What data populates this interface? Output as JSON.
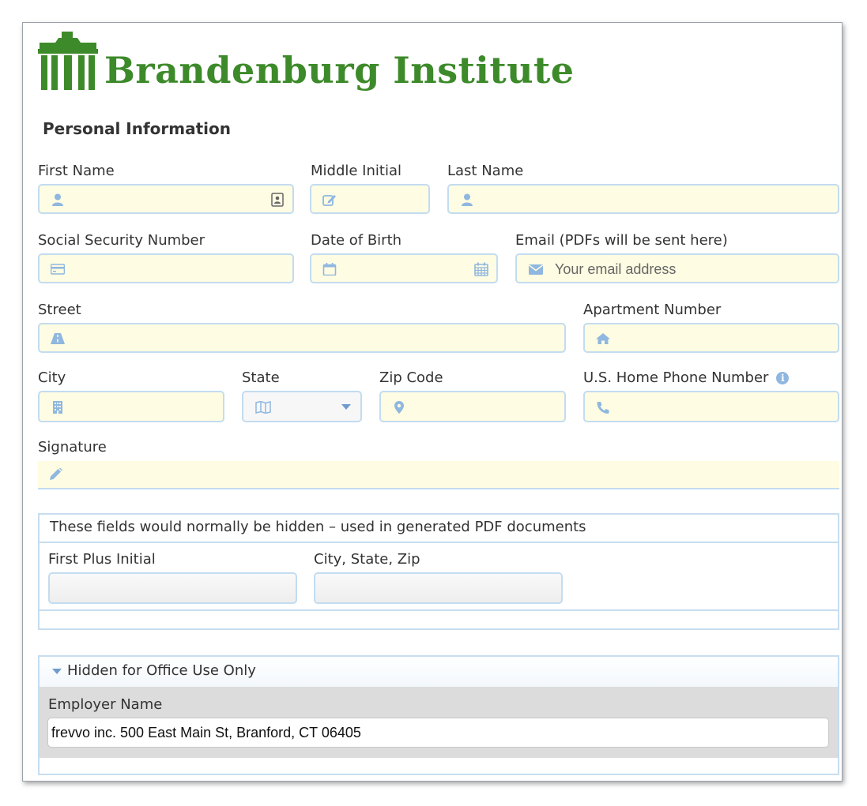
{
  "brand": {
    "name": "Brandenburg Institute",
    "color": "#3d8a2a"
  },
  "section": {
    "title": "Personal Information"
  },
  "fields": {
    "first_name": {
      "label": "First Name",
      "icon": "user-icon",
      "right_icon": "contact-card-icon"
    },
    "middle_initial": {
      "label": "Middle Initial",
      "icon": "edit-icon"
    },
    "last_name": {
      "label": "Last Name",
      "icon": "user-icon"
    },
    "ssn": {
      "label": "Social Security Number",
      "icon": "credit-card-icon"
    },
    "dob": {
      "label": "Date of Birth",
      "icon": "calendar-icon",
      "right_icon": "calendar-grid-icon"
    },
    "email": {
      "label": "Email (PDFs will be sent here)",
      "icon": "envelope-icon",
      "placeholder": "Your email address"
    },
    "street": {
      "label": "Street",
      "icon": "road-icon"
    },
    "apartment": {
      "label": "Apartment Number",
      "icon": "home-icon"
    },
    "city": {
      "label": "City",
      "icon": "building-icon"
    },
    "state": {
      "label": "State",
      "icon": "map-icon",
      "value": ""
    },
    "zip": {
      "label": "Zip Code",
      "icon": "map-marker-icon"
    },
    "phone": {
      "label": "U.S. Home Phone Number",
      "icon": "phone-icon",
      "help_icon": "info-icon"
    },
    "signature": {
      "label": "Signature",
      "icon": "pencil-icon"
    }
  },
  "hidden_panel": {
    "title": "These fields would normally be hidden – used in generated PDF documents",
    "first_plus_initial": {
      "label": "First Plus Initial",
      "value": ""
    },
    "city_state_zip": {
      "label": "City, State, Zip",
      "value": ""
    }
  },
  "office_panel": {
    "title": "Hidden for Office Use Only",
    "employer_name": {
      "label": "Employer Name",
      "value": "frevvo inc. 500 East Main St, Branford, CT 06405"
    }
  },
  "colors": {
    "field_bg": "#fefce2",
    "field_border": "#c3dcf0",
    "icon": "#8fb7e0"
  }
}
